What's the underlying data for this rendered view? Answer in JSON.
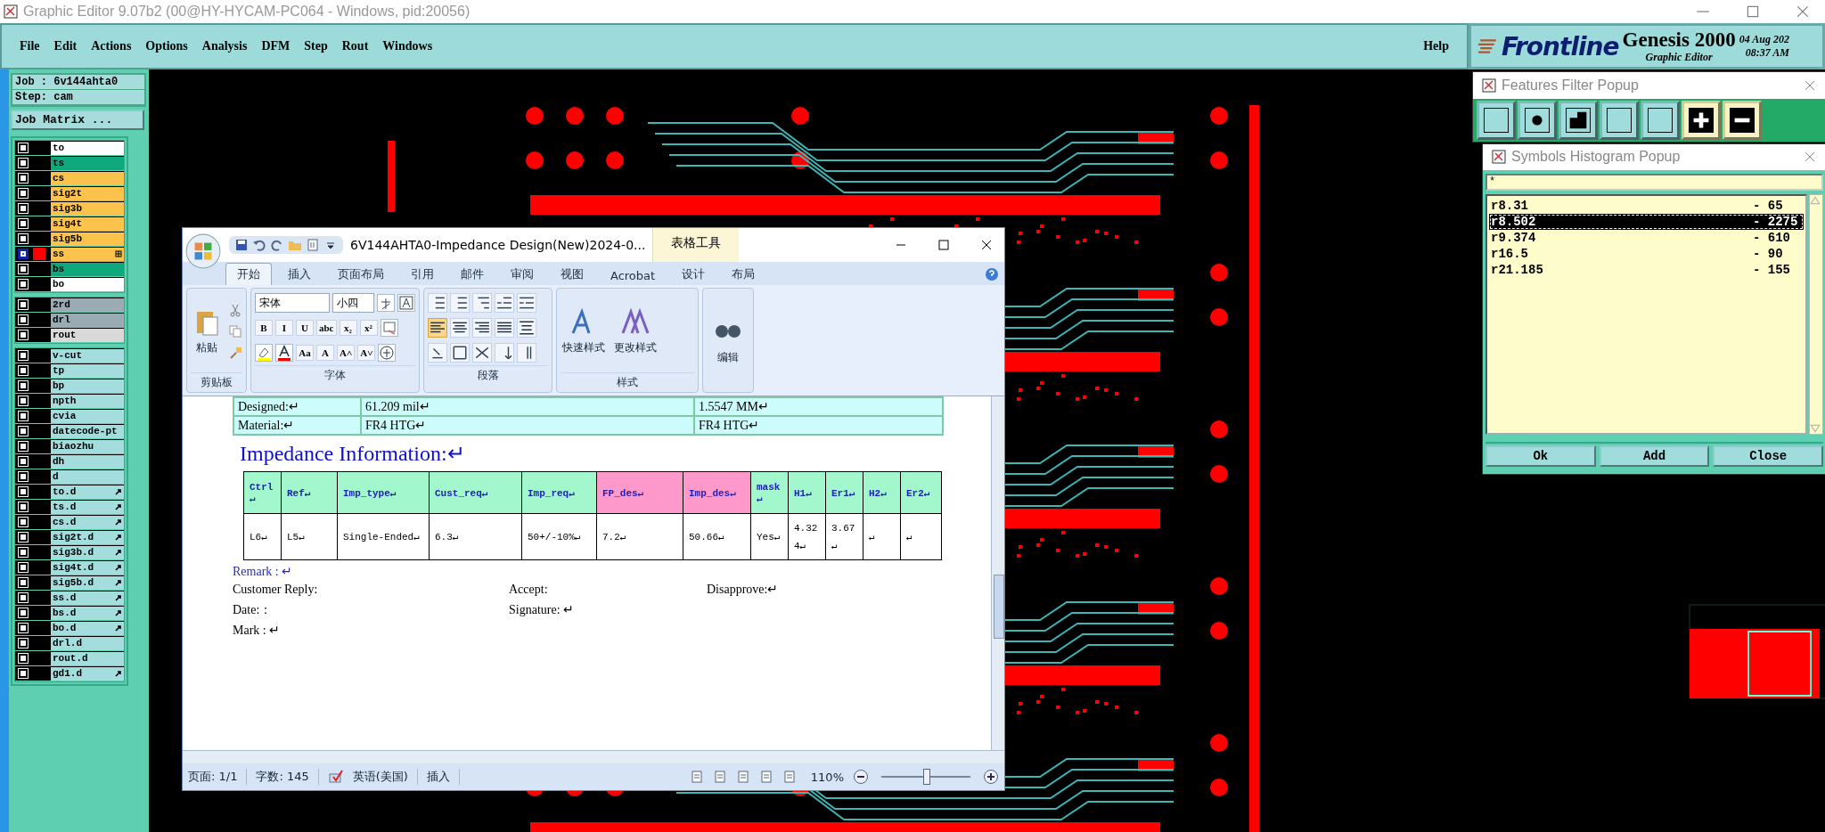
{
  "window": {
    "title": "Graphic Editor 9.07b2 (00@HY-HYCAM-PC064 - Windows, pid:20056)"
  },
  "menu": [
    "File",
    "Edit",
    "Actions",
    "Options",
    "Analysis",
    "DFM",
    "Step",
    "Rout",
    "Windows"
  ],
  "help_menu": "Help",
  "header": {
    "logo": "Frontline",
    "product": "Genesis 2000",
    "subtitle": "Graphic Editor",
    "date": "04 Aug 202",
    "time": "08:37 AM"
  },
  "job": {
    "job": "Job : 6v144ahta0",
    "step": "Step: cam",
    "matrix_button": "Job Matrix ..."
  },
  "layer_groups": [
    {
      "layers": [
        {
          "name": "to",
          "color": "#ffffff",
          "selected": false
        },
        {
          "name": "ts",
          "color": "#0fa77c",
          "selected": false
        },
        {
          "name": "cs",
          "color": "#fbc24c",
          "selected": false
        },
        {
          "name": "sig2t",
          "color": "#fbc24c",
          "selected": false
        },
        {
          "name": "sig3b",
          "color": "#fbc24c",
          "selected": false
        },
        {
          "name": "sig4t",
          "color": "#fbc24c",
          "selected": false
        },
        {
          "name": "sig5b",
          "color": "#fbc24c",
          "selected": false
        },
        {
          "name": "ss",
          "color": "#fbc24c",
          "selected": true,
          "symbol_mark": true
        },
        {
          "name": "bs",
          "color": "#0fa77c",
          "selected": false
        },
        {
          "name": "bo",
          "color": "#ffffff",
          "selected": false
        }
      ]
    },
    {
      "layers": [
        {
          "name": "2rd",
          "color": "#9aabb4",
          "selected": false
        },
        {
          "name": "drl",
          "color": "#9aabb4",
          "selected": false
        },
        {
          "name": "rout",
          "color": "#d9d9d9",
          "selected": false
        }
      ]
    },
    {
      "layers": [
        {
          "name": "v-cut",
          "color": "#a3dddd",
          "selected": false
        },
        {
          "name": "tp",
          "color": "#a3dddd",
          "selected": false
        },
        {
          "name": "bp",
          "color": "#a3dddd",
          "selected": false
        },
        {
          "name": "npth",
          "color": "#a3dddd",
          "selected": false
        },
        {
          "name": "cvia",
          "color": "#a3dddd",
          "selected": false
        },
        {
          "name": "datecode-pt",
          "color": "#a3dddd",
          "selected": false
        },
        {
          "name": "biaozhu",
          "color": "#a3dddd",
          "selected": false
        },
        {
          "name": "dh",
          "color": "#a3dddd",
          "selected": false
        },
        {
          "name": "d",
          "color": "#a3dddd",
          "selected": false
        },
        {
          "name": "to.d",
          "color": "#a3dddd",
          "selected": false,
          "arrow_mark": true
        },
        {
          "name": "ts.d",
          "color": "#a3dddd",
          "selected": false,
          "arrow_mark": true
        },
        {
          "name": "cs.d",
          "color": "#a3dddd",
          "selected": false,
          "arrow_mark": true
        },
        {
          "name": "sig2t.d",
          "color": "#a3dddd",
          "selected": false,
          "arrow_mark": true
        },
        {
          "name": "sig3b.d",
          "color": "#a3dddd",
          "selected": false,
          "arrow_mark": true
        },
        {
          "name": "sig4t.d",
          "color": "#a3dddd",
          "selected": false,
          "arrow_mark": true
        },
        {
          "name": "sig5b.d",
          "color": "#a3dddd",
          "selected": false,
          "arrow_mark": true
        },
        {
          "name": "ss.d",
          "color": "#a3dddd",
          "selected": false,
          "arrow_mark": true
        },
        {
          "name": "bs.d",
          "color": "#a3dddd",
          "selected": false,
          "arrow_mark": true
        },
        {
          "name": "bo.d",
          "color": "#a3dddd",
          "selected": false,
          "arrow_mark": true
        },
        {
          "name": "drl.d",
          "color": "#a3dddd",
          "selected": false
        },
        {
          "name": "rout.d",
          "color": "#a3dddd",
          "selected": false
        },
        {
          "name": "gd1.d",
          "color": "#a3dddd",
          "selected": false,
          "arrow_mark": true
        }
      ]
    }
  ],
  "features_filter": {
    "title": "Features Filter Popup",
    "tools": [
      {
        "kind": "line"
      },
      {
        "kind": "pad"
      },
      {
        "kind": "surface"
      },
      {
        "kind": "arc"
      },
      {
        "kind": "text"
      },
      {
        "kind": "positive"
      },
      {
        "kind": "negative"
      }
    ]
  },
  "histogram": {
    "title": "Symbols Histogram Popup",
    "filter": "*",
    "symbols": [
      {
        "name": "r8.31",
        "count": "- 65",
        "selected": false
      },
      {
        "name": "r8.502",
        "count": "- 2275",
        "selected": true
      },
      {
        "name": "r9.374",
        "count": "- 610",
        "selected": false
      },
      {
        "name": "r16.5",
        "count": "- 90",
        "selected": false
      },
      {
        "name": "r21.185",
        "count": "- 155",
        "selected": false
      }
    ],
    "buttons": [
      "Ok",
      "Add",
      "Close"
    ]
  },
  "word": {
    "title": "6V144AHTA0-Impedance Design(New)2024-0...",
    "context_tab": "表格工具",
    "tabs": [
      {
        "label": "开始",
        "selected": true
      },
      {
        "label": "插入",
        "selected": false
      },
      {
        "label": "页面布局",
        "selected": false
      },
      {
        "label": "引用",
        "selected": false
      },
      {
        "label": "邮件",
        "selected": false
      },
      {
        "label": "审阅",
        "selected": false
      },
      {
        "label": "视图",
        "selected": false
      },
      {
        "label": "Acrobat",
        "selected": false
      },
      {
        "label": "设计",
        "selected": false
      },
      {
        "label": "布局",
        "selected": false
      }
    ],
    "clipboard": {
      "paste": "粘贴",
      "label": "剪贴板"
    },
    "font": {
      "label": "字体",
      "name": "宋体",
      "size": "小四",
      "row2": [
        "B",
        "I",
        "U",
        "abc",
        "x₂",
        "x²"
      ],
      "row3": [
        "Aa",
        "A",
        "A˄",
        "A˅"
      ]
    },
    "paragraph": {
      "label": "段落",
      "row1": [
        {
          "kind": "bullets"
        },
        {
          "kind": "numbering"
        },
        {
          "kind": "multilevel"
        },
        {
          "kind": "outdent"
        },
        {
          "kind": "indent"
        }
      ],
      "alignments": [
        {
          "kind": "left",
          "selected": true
        },
        {
          "kind": "center",
          "selected": false
        },
        {
          "kind": "right",
          "selected": false
        },
        {
          "kind": "justify",
          "selected": false
        },
        {
          "kind": "distributed",
          "selected": false
        }
      ],
      "row3": [
        {
          "kind": "shading"
        },
        {
          "kind": "borders"
        },
        {
          "kind": "asian"
        },
        {
          "kind": "sort"
        },
        {
          "kind": "marks"
        }
      ]
    },
    "styles": {
      "label": "样式",
      "quick": "快速样式",
      "change": "更改样式"
    },
    "editing": "编辑",
    "info_rows": [
      [
        "Designed:↵",
        "61.209 mil↵",
        "1.5547 MM↵"
      ],
      [
        "Material:↵",
        "FR4 HTG↵",
        "FR4 HTG↵"
      ]
    ],
    "heading": "Impedance Information:↵",
    "columns": [
      {
        "label": "Ctrl↵",
        "color": "#a3f7cc"
      },
      {
        "label": "Ref↵",
        "color": "#a3f7cc"
      },
      {
        "label": "Imp_type↵",
        "color": "#a3f7cc"
      },
      {
        "label": "Cust_req↵",
        "color": "#a3f7cc"
      },
      {
        "label": "Imp_req↵",
        "color": "#a3f7cc"
      },
      {
        "label": "FP_des↵",
        "color": "#ff99cc"
      },
      {
        "label": "Imp_des↵",
        "color": "#ff99cc"
      },
      {
        "label": "mask↵",
        "color": "#a3f7cc"
      },
      {
        "label": "H1↵",
        "color": "#a3f7cc"
      },
      {
        "label": "Er1↵",
        "color": "#a3f7cc"
      },
      {
        "label": "H2↵",
        "color": "#a3f7cc"
      },
      {
        "label": "Er2↵",
        "color": "#a3f7cc"
      }
    ],
    "rows": [
      [
        "L6↵",
        "L5↵",
        "Single-Ended↵",
        "6.3↵",
        "50+/-10%↵",
        "7.2↵",
        "50.66↵",
        "Yes↵",
        "4.324↵",
        "3.67↵",
        "↵",
        "↵"
      ]
    ],
    "remark": "Remark : ↵",
    "remark_lines": [
      {
        "column_1": "Customer Reply:",
        "column_2": "Accept:",
        "column_3": "Disapprove:↵"
      },
      {
        "column_1": "Date:：",
        "column_2": "Signature: ↵"
      },
      {
        "column_1": "Mark : ↵"
      }
    ],
    "status": {
      "page": "页面: 1/1",
      "words": "字数: 145",
      "language": "英语(美国)",
      "mode": "插入",
      "zoom": "110%",
      "zoom_slider": {
        "level": 0.5
      }
    }
  }
}
